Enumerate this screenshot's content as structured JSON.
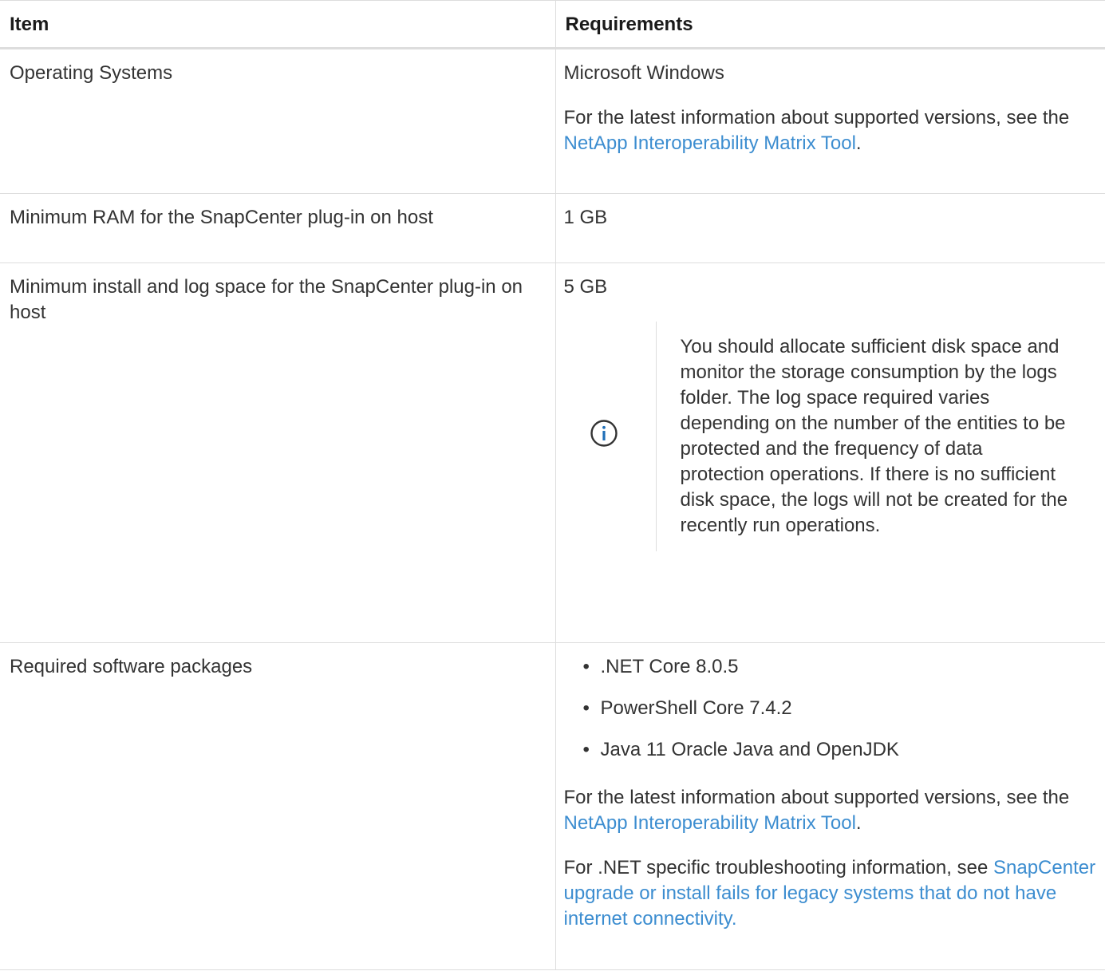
{
  "table": {
    "headers": {
      "item": "Item",
      "requirements": "Requirements"
    },
    "rows": [
      {
        "item": "Operating Systems",
        "requirement": "Microsoft Windows",
        "info_prefix": "For the latest information about supported versions, see the ",
        "info_link": "NetApp Interoperability Matrix Tool",
        "info_suffix": "."
      },
      {
        "item": "Minimum RAM for the SnapCenter plug-in on host",
        "requirement": "1 GB"
      },
      {
        "item": "Minimum install and log space for the SnapCenter plug-in on host",
        "requirement": "5 GB",
        "note_icon": "info-icon",
        "note": "You should allocate sufficient disk space and monitor the storage consumption by the logs folder. The log space required varies depending on the number of the entities to be protected and the frequency of data protection operations. If there is no sufficient disk space, the logs will not be created for the recently run operations."
      },
      {
        "item": "Required software packages",
        "packages": [
          ".NET Core 8.0.5",
          "PowerShell Core 7.4.2",
          "Java 11 Oracle Java and OpenJDK"
        ],
        "info_prefix": "For the latest information about supported versions, see the ",
        "info_link": "NetApp Interoperability Matrix Tool",
        "info_suffix": ".",
        "troubleshoot_prefix": "For .NET specific troubleshooting information, see ",
        "troubleshoot_link": "SnapCenter upgrade or install fails for legacy systems that do not have internet connectivity."
      }
    ]
  },
  "colors": {
    "text": "#333333",
    "link": "#3c8dd0",
    "border": "#dddddd",
    "icon": "#1f6fb8"
  }
}
